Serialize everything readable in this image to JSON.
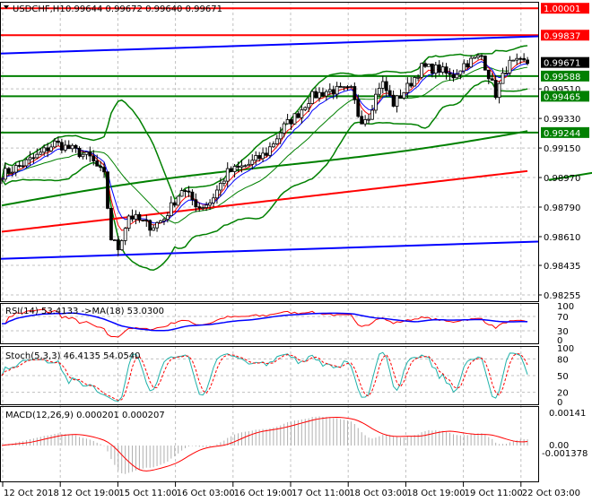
{
  "header": {
    "symbol": "USDCHF,H1",
    "quote": "0.99644 0.99672 0.99640 0.99671"
  },
  "price_axis": {
    "ticks": [
      "0.99510",
      "0.99330",
      "0.99150",
      "0.98970",
      "0.98790",
      "0.98610",
      "0.98435",
      "0.98255"
    ],
    "tick_values": [
      0.9951,
      0.9933,
      0.9915,
      0.9897,
      0.9879,
      0.9861,
      0.98435,
      0.98255
    ],
    "tags": [
      {
        "label": "1.00001",
        "value": 1.00001,
        "color": "#ff0000"
      },
      {
        "label": "0.99837",
        "value": 0.99837,
        "color": "#ff0000"
      },
      {
        "label": "0.99671",
        "value": 0.99671,
        "color": "#000000"
      },
      {
        "label": "0.99588",
        "value": 0.99588,
        "color": "#008000"
      },
      {
        "label": "0.99465",
        "value": 0.99465,
        "color": "#008000"
      },
      {
        "label": "0.99244",
        "value": 0.99244,
        "color": "#008000"
      }
    ]
  },
  "chart_data": {
    "type": "candlestick",
    "price_path": [
      [
        0,
        0.9899
      ],
      [
        10,
        0.9904
      ],
      [
        20,
        0.991
      ],
      [
        30,
        0.9918
      ],
      [
        40,
        0.9914
      ],
      [
        50,
        0.9909
      ],
      [
        58,
        0.9898
      ],
      [
        62,
        0.986
      ],
      [
        66,
        0.9854
      ],
      [
        72,
        0.9874
      ],
      [
        85,
        0.9867
      ],
      [
        92,
        0.9872
      ],
      [
        102,
        0.989
      ],
      [
        112,
        0.9879
      ],
      [
        118,
        0.9882
      ],
      [
        128,
        0.99
      ],
      [
        140,
        0.9905
      ],
      [
        150,
        0.9912
      ],
      [
        160,
        0.9928
      ],
      [
        168,
        0.9936
      ],
      [
        175,
        0.9946
      ],
      [
        185,
        0.995
      ],
      [
        198,
        0.995
      ],
      [
        203,
        0.9932
      ],
      [
        208,
        0.9935
      ],
      [
        215,
        0.9956
      ],
      [
        222,
        0.9942
      ],
      [
        230,
        0.9952
      ],
      [
        238,
        0.9964
      ],
      [
        248,
        0.9963
      ],
      [
        255,
        0.9958
      ],
      [
        262,
        0.9966
      ],
      [
        272,
        0.9971
      ],
      [
        280,
        0.9948
      ],
      [
        287,
        0.9966
      ],
      [
        296,
        0.9967
      ]
    ],
    "levels": [
      1.00001,
      0.99837,
      0.99588,
      0.99465,
      0.99244
    ],
    "upper_channel": [
      0.99725,
      0.9983
    ],
    "lower_channel": [
      0.98475,
      0.9858
    ],
    "support_trend": [
      [
        155,
        0.98955
      ],
      [
        300,
        0.99465
      ]
    ],
    "bars": 150
  },
  "rsi": {
    "label": "RSI(14) 53.4133  ->MA(18) 53.0300",
    "ticks": [
      "100",
      "70",
      "30",
      "0"
    ]
  },
  "stoch": {
    "label": "Stoch(5,3,3) 46.4135 54.0540",
    "ticks": [
      "100",
      "80",
      "50",
      "20",
      "0"
    ]
  },
  "macd": {
    "label": "MACD(12,26,9) 0.000201 0.000207",
    "ticks": [
      "0.00141",
      "0.00",
      "-0.001378"
    ]
  },
  "time_axis": [
    "12 Oct 2018",
    "12 Oct 19:00",
    "15 Oct 11:00",
    "16 Oct 03:00",
    "16 Oct 19:00",
    "17 Oct 11:00",
    "18 Oct 03:00",
    "18 Oct 19:00",
    "19 Oct 11:00",
    "22 Oct 03:00"
  ]
}
